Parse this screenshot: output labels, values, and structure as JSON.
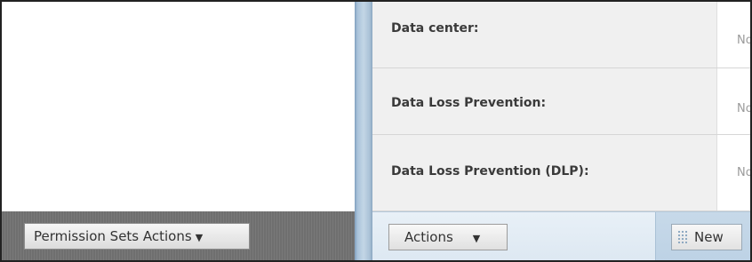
{
  "left_panel": {
    "permission_sets_actions_label": "Permission Sets Actions",
    "caret": "▼"
  },
  "detail": {
    "rows": [
      {
        "label": "Data center:",
        "value": "No"
      },
      {
        "label": "Data Loss Prevention:",
        "value": "No"
      },
      {
        "label": "Data Loss Prevention (DLP):",
        "value": "No"
      }
    ]
  },
  "toolbar": {
    "actions_label": "Actions",
    "actions_caret": "▼",
    "new_label": "New"
  },
  "colors": {
    "left_bar": "#6f6f6f",
    "divider": "#a8c2d9",
    "bottom_bar": "#d2e2ef",
    "label_cell": "#f0f0f0"
  }
}
